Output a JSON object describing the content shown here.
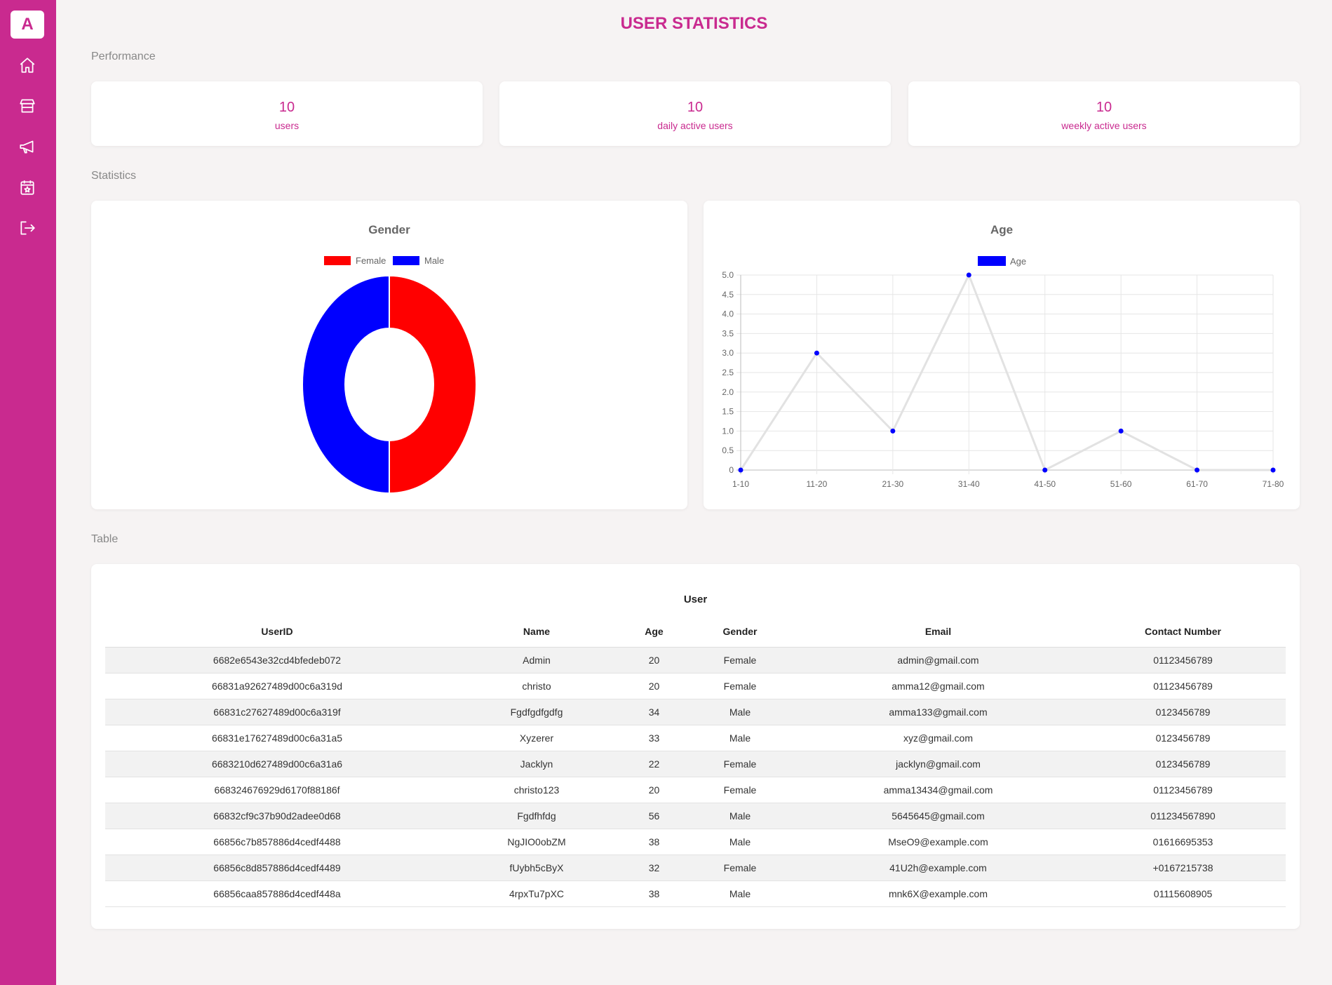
{
  "app": {
    "logo_letter": "A",
    "accent_color": "#c92a8f"
  },
  "sidebar": {
    "items": [
      {
        "name": "home",
        "icon": "home-icon"
      },
      {
        "name": "store",
        "icon": "store-icon"
      },
      {
        "name": "announcements",
        "icon": "megaphone-icon"
      },
      {
        "name": "events",
        "icon": "calendar-star-icon"
      },
      {
        "name": "logout",
        "icon": "logout-icon"
      }
    ]
  },
  "header": {
    "title": "USER STATISTICS"
  },
  "sections": {
    "performance": "Performance",
    "statistics": "Statistics",
    "table": "Table"
  },
  "performance": {
    "cards": [
      {
        "value": "10",
        "label": "users"
      },
      {
        "value": "10",
        "label": "daily active users"
      },
      {
        "value": "10",
        "label": "weekly active users"
      }
    ]
  },
  "chart_data": [
    {
      "type": "pie",
      "title": "Gender",
      "categories": [
        "Female",
        "Male"
      ],
      "values": [
        5,
        5
      ],
      "colors": [
        "#ff0000",
        "#0000ff"
      ],
      "legend": "top",
      "donut": true
    },
    {
      "type": "line",
      "title": "Age",
      "categories": [
        "1-10",
        "11-20",
        "21-30",
        "31-40",
        "41-50",
        "51-60",
        "61-70",
        "71-80"
      ],
      "series": [
        {
          "name": "Age",
          "values": [
            0,
            3,
            1,
            5,
            0,
            1,
            0,
            0
          ],
          "color": "#0000ff"
        }
      ],
      "yticks": [
        "0",
        "0.5",
        "1.0",
        "1.5",
        "2.0",
        "2.5",
        "3.0",
        "3.5",
        "4.0",
        "4.5",
        "5.0"
      ],
      "ylim": [
        0,
        5
      ],
      "grid": true,
      "legend": "top"
    }
  ],
  "table": {
    "title": "User",
    "columns": [
      "UserID",
      "Name",
      "Age",
      "Gender",
      "Email",
      "Contact Number"
    ],
    "rows": [
      [
        "6682e6543e32cd4bfedeb072",
        "Admin",
        "20",
        "Female",
        "admin@gmail.com",
        "01123456789"
      ],
      [
        "66831a92627489d00c6a319d",
        "christo",
        "20",
        "Female",
        "amma12@gmail.com",
        "01123456789"
      ],
      [
        "66831c27627489d00c6a319f",
        "Fgdfgdfgdfg",
        "34",
        "Male",
        "amma133@gmail.com",
        "0123456789"
      ],
      [
        "66831e17627489d00c6a31a5",
        "Xyzerer",
        "33",
        "Male",
        "xyz@gmail.com",
        "0123456789"
      ],
      [
        "6683210d627489d00c6a31a6",
        "Jacklyn",
        "22",
        "Female",
        "jacklyn@gmail.com",
        "0123456789"
      ],
      [
        "668324676929d6170f88186f",
        "christo123",
        "20",
        "Female",
        "amma13434@gmail.com",
        "01123456789"
      ],
      [
        "66832cf9c37b90d2adee0d68",
        "Fgdfhfdg",
        "56",
        "Male",
        "5645645@gmail.com",
        "011234567890"
      ],
      [
        "66856c7b857886d4cedf4488",
        "NgJIO0obZM",
        "38",
        "Male",
        "MseO9@example.com",
        "01616695353"
      ],
      [
        "66856c8d857886d4cedf4489",
        "fUybh5cByX",
        "32",
        "Female",
        "41U2h@example.com",
        "+0167215738"
      ],
      [
        "66856caa857886d4cedf448a",
        "4rpxTu7pXC",
        "38",
        "Male",
        "mnk6X@example.com",
        "01115608905"
      ]
    ]
  }
}
